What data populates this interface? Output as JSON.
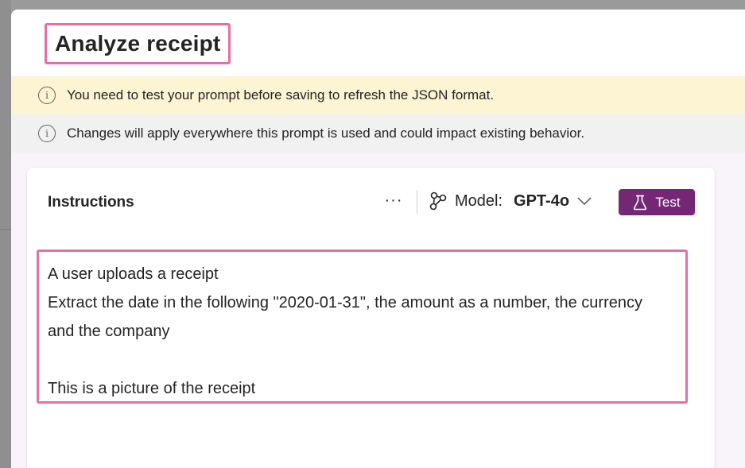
{
  "dialog": {
    "title": "Analyze receipt"
  },
  "banners": {
    "warning": {
      "icon": "info-icon",
      "text": "You need to test your prompt before saving to refresh the JSON format."
    },
    "info": {
      "icon": "info-icon",
      "text": "Changes will apply everywhere this prompt is used and could impact existing behavior."
    }
  },
  "card": {
    "title": "Instructions",
    "more_label": "···",
    "model": {
      "icon": "model-icon",
      "label": "Model:",
      "value": "GPT-4o"
    },
    "test_button": {
      "icon": "beaker-icon",
      "label": "Test"
    }
  },
  "instructions": {
    "lines": [
      "A user uploads a receipt",
      "Extract the date in the following \"2020-01-31\", the amount as a number, the currency",
      "and the company",
      "",
      "This is a picture of the receipt"
    ]
  },
  "colors": {
    "accent": "#742774",
    "highlight": "#e46fa8",
    "warning_bg": "#fcf4d3",
    "info_bg": "#f2f1f1",
    "content_bg": "#f8f4f9"
  }
}
